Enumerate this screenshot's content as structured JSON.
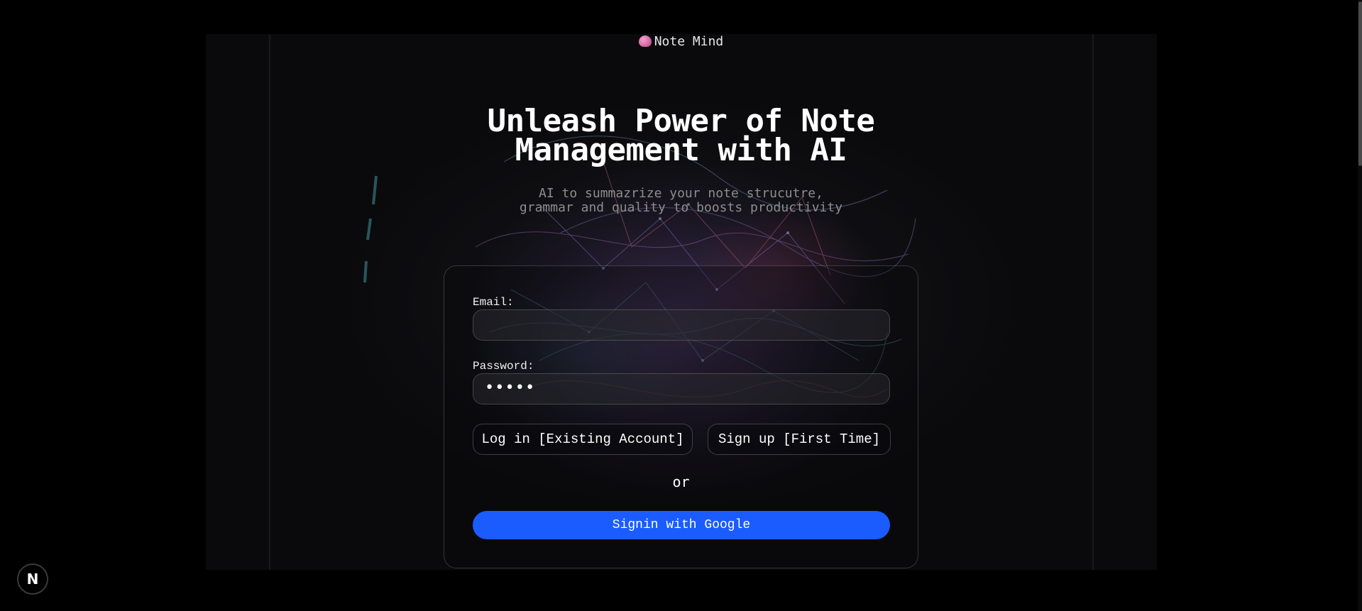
{
  "app": {
    "brand_name": "Note Mind",
    "brand_icon": "brain-icon",
    "brand_icon_color": "#d05c9c"
  },
  "hero": {
    "headline_line1": "Unleash Power of Note",
    "headline_line2": "Management with AI",
    "subtitle_line1": "AI to summazrize your note strucutre,",
    "subtitle_line2": "grammar and quality to boosts productivity"
  },
  "form": {
    "email_label": "Email:",
    "email_value": "",
    "password_label": "Password:",
    "password_masked": "•••••",
    "login_label": "Log in [Existing Account]",
    "signup_label": "Sign up [First Time]",
    "or_text": "or",
    "google_label": "Signin with Google",
    "google_button_color": "#1a5cff"
  },
  "dev_badge": {
    "label": "N",
    "icon": "nextjs-icon"
  }
}
